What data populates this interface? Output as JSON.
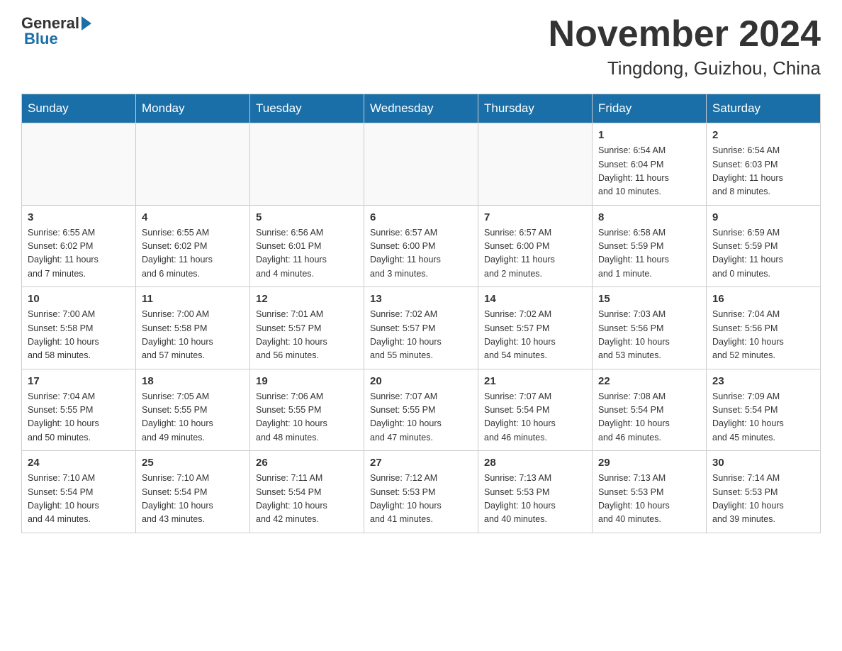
{
  "logo": {
    "general": "General",
    "blue": "Blue"
  },
  "header": {
    "month_title": "November 2024",
    "location": "Tingdong, Guizhou, China"
  },
  "days_of_week": [
    "Sunday",
    "Monday",
    "Tuesday",
    "Wednesday",
    "Thursday",
    "Friday",
    "Saturday"
  ],
  "weeks": [
    [
      {
        "day": "",
        "info": ""
      },
      {
        "day": "",
        "info": ""
      },
      {
        "day": "",
        "info": ""
      },
      {
        "day": "",
        "info": ""
      },
      {
        "day": "",
        "info": ""
      },
      {
        "day": "1",
        "info": "Sunrise: 6:54 AM\nSunset: 6:04 PM\nDaylight: 11 hours\nand 10 minutes."
      },
      {
        "day": "2",
        "info": "Sunrise: 6:54 AM\nSunset: 6:03 PM\nDaylight: 11 hours\nand 8 minutes."
      }
    ],
    [
      {
        "day": "3",
        "info": "Sunrise: 6:55 AM\nSunset: 6:02 PM\nDaylight: 11 hours\nand 7 minutes."
      },
      {
        "day": "4",
        "info": "Sunrise: 6:55 AM\nSunset: 6:02 PM\nDaylight: 11 hours\nand 6 minutes."
      },
      {
        "day": "5",
        "info": "Sunrise: 6:56 AM\nSunset: 6:01 PM\nDaylight: 11 hours\nand 4 minutes."
      },
      {
        "day": "6",
        "info": "Sunrise: 6:57 AM\nSunset: 6:00 PM\nDaylight: 11 hours\nand 3 minutes."
      },
      {
        "day": "7",
        "info": "Sunrise: 6:57 AM\nSunset: 6:00 PM\nDaylight: 11 hours\nand 2 minutes."
      },
      {
        "day": "8",
        "info": "Sunrise: 6:58 AM\nSunset: 5:59 PM\nDaylight: 11 hours\nand 1 minute."
      },
      {
        "day": "9",
        "info": "Sunrise: 6:59 AM\nSunset: 5:59 PM\nDaylight: 11 hours\nand 0 minutes."
      }
    ],
    [
      {
        "day": "10",
        "info": "Sunrise: 7:00 AM\nSunset: 5:58 PM\nDaylight: 10 hours\nand 58 minutes."
      },
      {
        "day": "11",
        "info": "Sunrise: 7:00 AM\nSunset: 5:58 PM\nDaylight: 10 hours\nand 57 minutes."
      },
      {
        "day": "12",
        "info": "Sunrise: 7:01 AM\nSunset: 5:57 PM\nDaylight: 10 hours\nand 56 minutes."
      },
      {
        "day": "13",
        "info": "Sunrise: 7:02 AM\nSunset: 5:57 PM\nDaylight: 10 hours\nand 55 minutes."
      },
      {
        "day": "14",
        "info": "Sunrise: 7:02 AM\nSunset: 5:57 PM\nDaylight: 10 hours\nand 54 minutes."
      },
      {
        "day": "15",
        "info": "Sunrise: 7:03 AM\nSunset: 5:56 PM\nDaylight: 10 hours\nand 53 minutes."
      },
      {
        "day": "16",
        "info": "Sunrise: 7:04 AM\nSunset: 5:56 PM\nDaylight: 10 hours\nand 52 minutes."
      }
    ],
    [
      {
        "day": "17",
        "info": "Sunrise: 7:04 AM\nSunset: 5:55 PM\nDaylight: 10 hours\nand 50 minutes."
      },
      {
        "day": "18",
        "info": "Sunrise: 7:05 AM\nSunset: 5:55 PM\nDaylight: 10 hours\nand 49 minutes."
      },
      {
        "day": "19",
        "info": "Sunrise: 7:06 AM\nSunset: 5:55 PM\nDaylight: 10 hours\nand 48 minutes."
      },
      {
        "day": "20",
        "info": "Sunrise: 7:07 AM\nSunset: 5:55 PM\nDaylight: 10 hours\nand 47 minutes."
      },
      {
        "day": "21",
        "info": "Sunrise: 7:07 AM\nSunset: 5:54 PM\nDaylight: 10 hours\nand 46 minutes."
      },
      {
        "day": "22",
        "info": "Sunrise: 7:08 AM\nSunset: 5:54 PM\nDaylight: 10 hours\nand 46 minutes."
      },
      {
        "day": "23",
        "info": "Sunrise: 7:09 AM\nSunset: 5:54 PM\nDaylight: 10 hours\nand 45 minutes."
      }
    ],
    [
      {
        "day": "24",
        "info": "Sunrise: 7:10 AM\nSunset: 5:54 PM\nDaylight: 10 hours\nand 44 minutes."
      },
      {
        "day": "25",
        "info": "Sunrise: 7:10 AM\nSunset: 5:54 PM\nDaylight: 10 hours\nand 43 minutes."
      },
      {
        "day": "26",
        "info": "Sunrise: 7:11 AM\nSunset: 5:54 PM\nDaylight: 10 hours\nand 42 minutes."
      },
      {
        "day": "27",
        "info": "Sunrise: 7:12 AM\nSunset: 5:53 PM\nDaylight: 10 hours\nand 41 minutes."
      },
      {
        "day": "28",
        "info": "Sunrise: 7:13 AM\nSunset: 5:53 PM\nDaylight: 10 hours\nand 40 minutes."
      },
      {
        "day": "29",
        "info": "Sunrise: 7:13 AM\nSunset: 5:53 PM\nDaylight: 10 hours\nand 40 minutes."
      },
      {
        "day": "30",
        "info": "Sunrise: 7:14 AM\nSunset: 5:53 PM\nDaylight: 10 hours\nand 39 minutes."
      }
    ]
  ]
}
